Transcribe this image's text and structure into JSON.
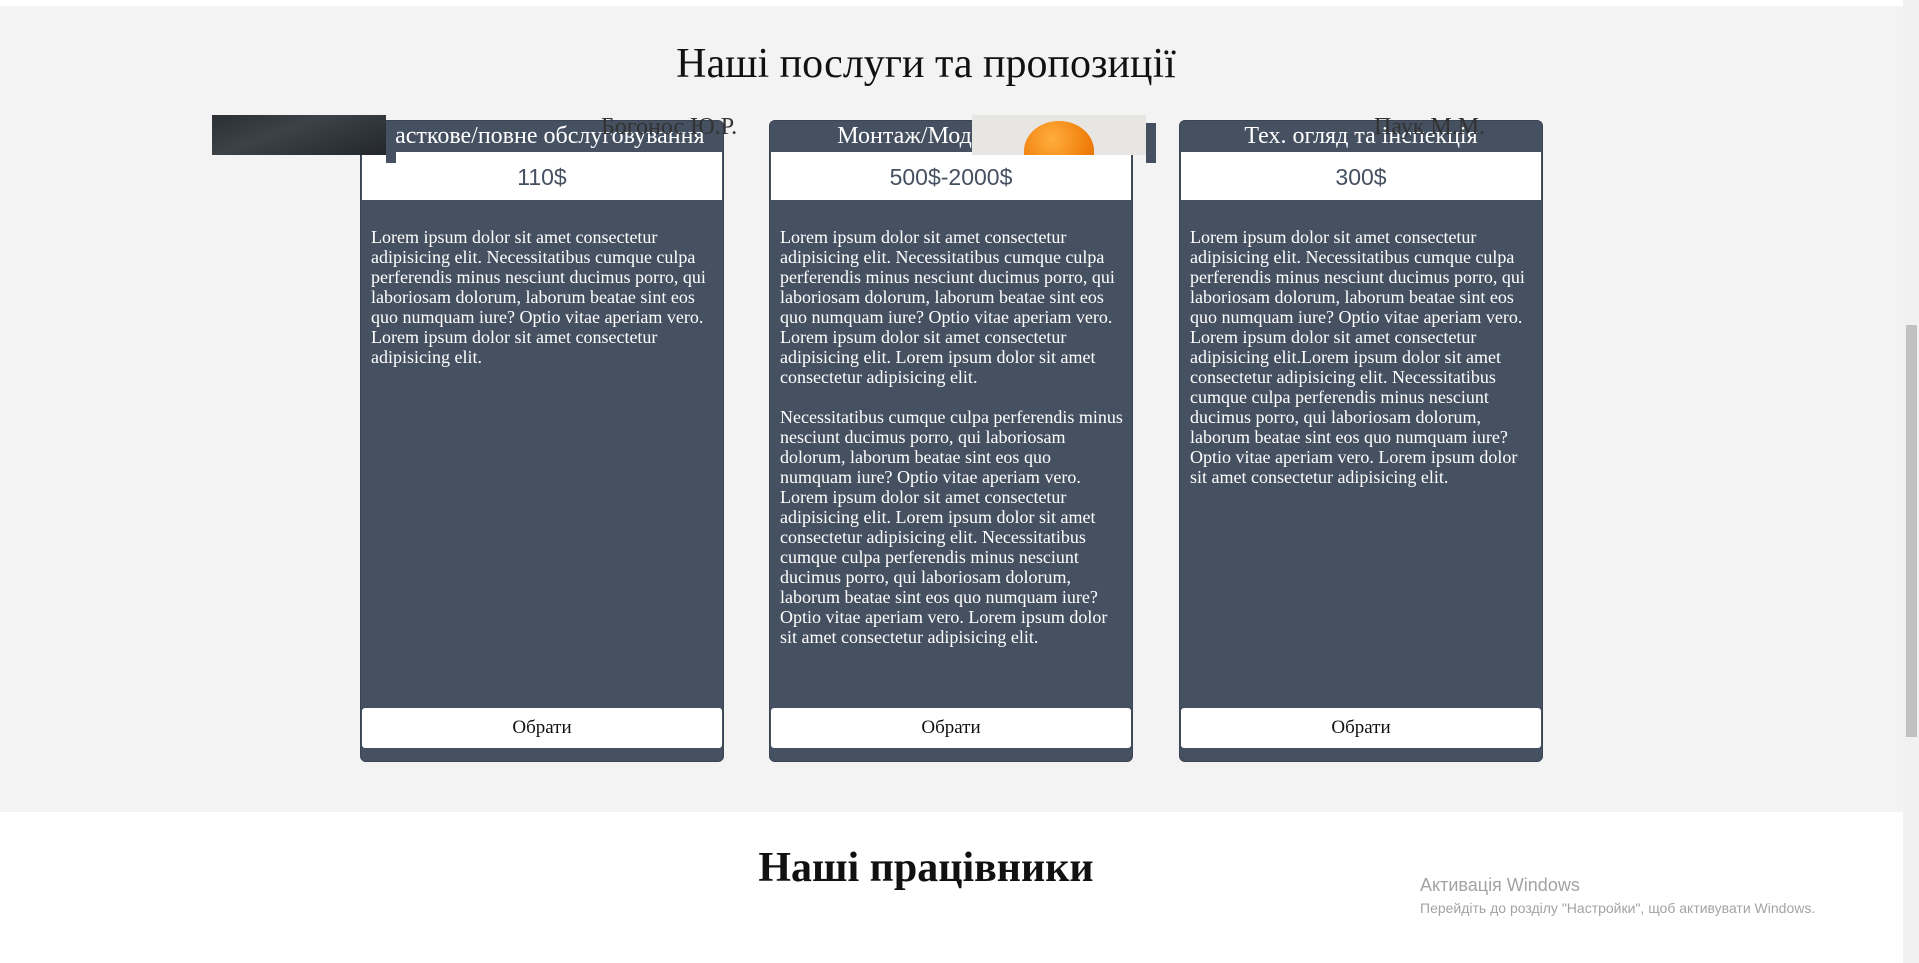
{
  "services": {
    "title": "Наші послуги та пропозиції",
    "cards": [
      {
        "title": "Часткове/повне обслуговування",
        "price": "110$",
        "paragraphs": [
          "Lorem ipsum dolor sit amet consectetur adipisicing elit. Necessitatibus cumque culpa perferendis minus nesciunt ducimus porro, qui laboriosam dolorum, laborum beatae sint eos quo numquam iure? Optio vitae aperiam vero. Lorem ipsum dolor sit amet consectetur adipisicing elit."
        ],
        "button": "Обрати"
      },
      {
        "title": "Монтаж/Модернізація",
        "price": "500$-2000$",
        "paragraphs": [
          "Lorem ipsum dolor sit amet consectetur adipisicing elit. Necessitatibus cumque culpa perferendis minus nesciunt ducimus porro, qui laboriosam dolorum, laborum beatae sint eos quo numquam iure? Optio vitae aperiam vero. Lorem ipsum dolor sit amet consectetur adipisicing elit. Lorem ipsum dolor sit amet consectetur adipisicing elit.",
          "Necessitatibus cumque culpa perferendis minus nesciunt ducimus porro, qui laboriosam dolorum, laborum beatae sint eos quo numquam iure? Optio vitae aperiam vero. Lorem ipsum dolor sit amet consectetur adipisicing elit. Lorem ipsum dolor sit amet consectetur adipisicing elit. Necessitatibus cumque culpa perferendis minus nesciunt ducimus porro, qui laboriosam dolorum, laborum beatae sint eos quo numquam iure? Optio vitae aperiam vero. Lorem ipsum dolor sit amet consectetur adipisicing elit."
        ],
        "button": "Обрати"
      },
      {
        "title": "Тех. огляд та інспекція",
        "price": "300$",
        "paragraphs": [
          "Lorem ipsum dolor sit amet consectetur adipisicing elit. Necessitatibus cumque culpa perferendis minus nesciunt ducimus porro, qui laboriosam dolorum, laborum beatae sint eos quo numquam iure? Optio vitae aperiam vero. Lorem ipsum dolor sit amet consectetur adipisicing elit.Lorem ipsum dolor sit amet consectetur adipisicing elit. Necessitatibus cumque culpa perferendis minus nesciunt ducimus porro, qui laboriosam dolorum, laborum beatae sint eos quo numquam iure? Optio vitae aperiam vero. Lorem ipsum dolor sit amet consectetur adipisicing elit."
        ],
        "button": "Обрати"
      }
    ]
  },
  "staff": {
    "title": "Наші працівники",
    "members": [
      {
        "name": "Богонос Ю.Р."
      },
      {
        "name": "Паук М.М."
      }
    ]
  },
  "activation": {
    "title": "Активація Windows",
    "subtitle": "Перейдіть до розділу \"Настройки\", щоб активувати Windows."
  },
  "colors": {
    "card_bg": "#455061",
    "section_bg": "#f3f3f3",
    "price_text": "#455061"
  }
}
